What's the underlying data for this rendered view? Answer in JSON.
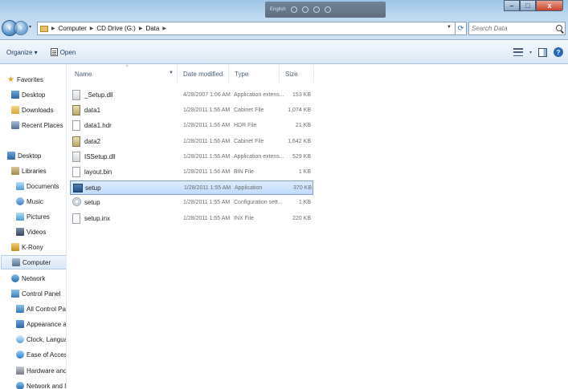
{
  "language_bar": {
    "label": "English"
  },
  "window_controls": {
    "minimize": "–",
    "maximize": "□",
    "close": "x"
  },
  "address_bar": {
    "crumbs": [
      "Computer",
      "CD Drive (G:)",
      "Data"
    ]
  },
  "search": {
    "placeholder": "Search Data"
  },
  "toolbar": {
    "organize": "Organize ▾",
    "open": "Open"
  },
  "columns": {
    "name": "Name",
    "date": "Date modified",
    "type": "Type",
    "size": "Size"
  },
  "nav": {
    "favorites": "Favorites",
    "desktop_fav": "Desktop",
    "downloads": "Downloads",
    "recent": "Recent Places",
    "desktop": "Desktop",
    "libraries": "Libraries",
    "documents": "Documents",
    "music": "Music",
    "pictures": "Pictures",
    "videos": "Videos",
    "user": "K-Rony",
    "computer": "Computer",
    "network": "Network",
    "control_panel": "Control Panel",
    "all_cp": "All Control Panel I",
    "appearance": "Appearance and P",
    "clock": "Clock, Language, a",
    "ease": "Ease of Access",
    "hardware": "Hardware and Sou",
    "network_internet": "Network and Inter"
  },
  "files": [
    {
      "name": "_Setup.dll",
      "date": "4/28/2007 1:06 AM",
      "type": "Application extens...",
      "size": "153 KB",
      "icon": "dll-file-icon"
    },
    {
      "name": "data1",
      "date": "1/28/2011 1:56 AM",
      "type": "Cabinet File",
      "size": "1,074 KB",
      "icon": "cabinet-file-icon"
    },
    {
      "name": "data1.hdr",
      "date": "1/28/2011 1:56 AM",
      "type": "HDR File",
      "size": "21 KB",
      "icon": "generic-file-icon"
    },
    {
      "name": "data2",
      "date": "1/28/2011 1:56 AM",
      "type": "Cabinet File",
      "size": "1,642 KB",
      "icon": "cabinet-file-icon"
    },
    {
      "name": "ISSetup.dll",
      "date": "1/28/2011 1:56 AM",
      "type": "Application extens...",
      "size": "529 KB",
      "icon": "dll-file-icon"
    },
    {
      "name": "layout.bin",
      "date": "1/28/2011 1:56 AM",
      "type": "BIN File",
      "size": "1 KB",
      "icon": "generic-file-icon"
    },
    {
      "name": "setup",
      "date": "1/28/2011 1:55 AM",
      "type": "Application",
      "size": "370 KB",
      "icon": "application-icon"
    },
    {
      "name": "setup",
      "date": "1/28/2011 1:55 AM",
      "type": "Configuration sett...",
      "size": "1 KB",
      "icon": "config-file-icon"
    },
    {
      "name": "setup.inx",
      "date": "1/28/2011 1:55 AM",
      "type": "INX File",
      "size": "220 KB",
      "icon": "generic-file-icon"
    }
  ]
}
